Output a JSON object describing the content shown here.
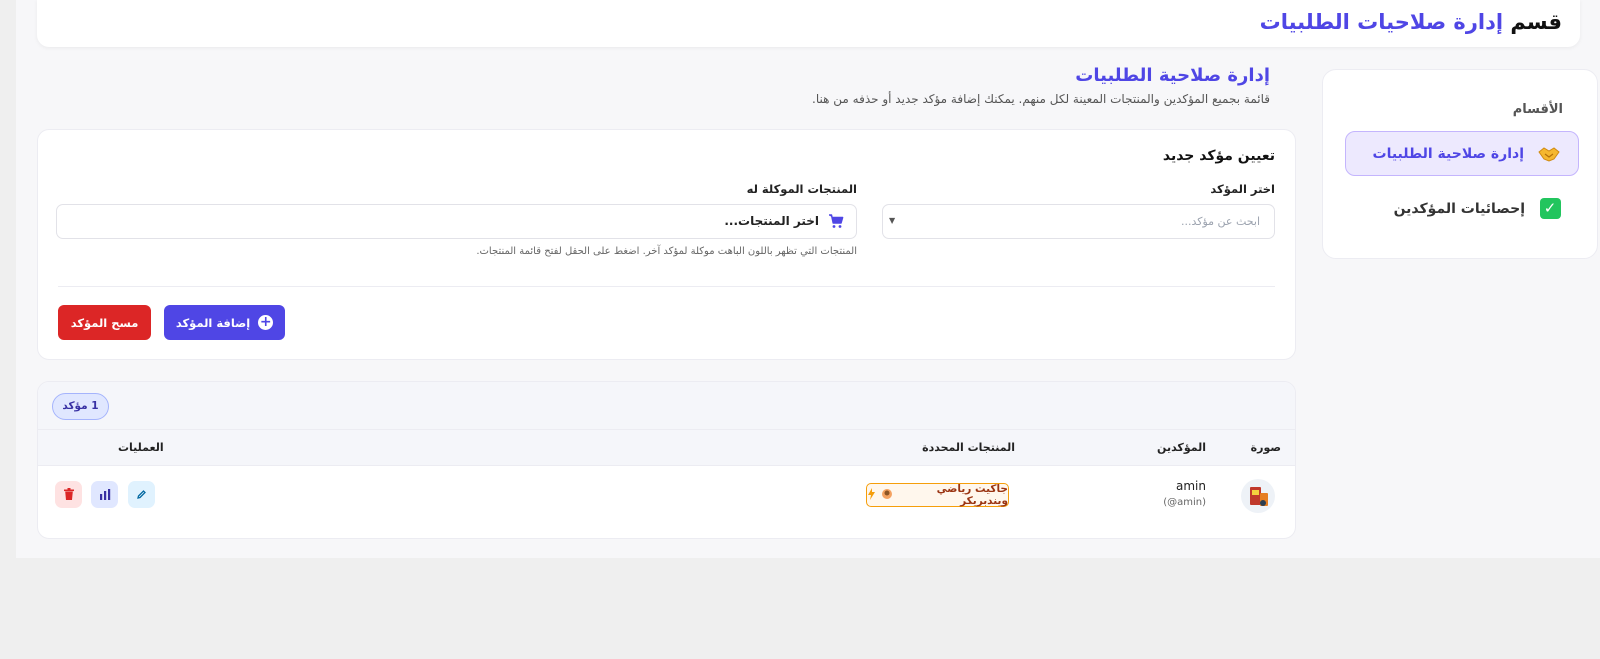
{
  "header": {
    "title_prefix": "قسم",
    "title_accent": "إدارة صلاحيات الطلبيات"
  },
  "sidebar": {
    "heading": "الأقسام",
    "items": [
      {
        "label": "إدارة صلاحية الطلبيات",
        "icon": "handshake-icon",
        "active": true
      },
      {
        "label": "إحصائيات المؤكدين",
        "icon": "check-box-icon",
        "active": false
      }
    ]
  },
  "page": {
    "title": "إدارة صلاحية الطلبيات",
    "description": "قائمة بجميع المؤكدين والمنتجات المعينة لكل منهم. يمكنك إضافة مؤكد جديد أو حذفه من هنا."
  },
  "assign_form": {
    "title": "تعيين مؤكد جديد",
    "confirmer_label": "اختر المؤكد",
    "confirmer_placeholder": "ابحث عن مؤكد...",
    "products_label": "المنتجات الموكلة له",
    "products_value": "اختر المنتجات...",
    "products_helper": "المنتجات التي تظهر باللون الباهت موكلة لمؤكد آخر. اضغط على الحقل لفتح قائمة المنتجات.",
    "add_button": "إضافة المؤكد",
    "clear_button": "مسح المؤكد"
  },
  "table": {
    "count_badge": "1 مؤكد",
    "columns": [
      "صورة",
      "المؤكدين",
      "المنتجات المحددة",
      "العمليات"
    ],
    "rows": [
      {
        "name": "amin",
        "handle": "(amin@)",
        "product": "جاكيت رياضي ويندبريكر"
      }
    ]
  },
  "colors": {
    "accent": "#4f46e5",
    "danger": "#dc2626",
    "product_tag_border": "#f59e0b"
  }
}
